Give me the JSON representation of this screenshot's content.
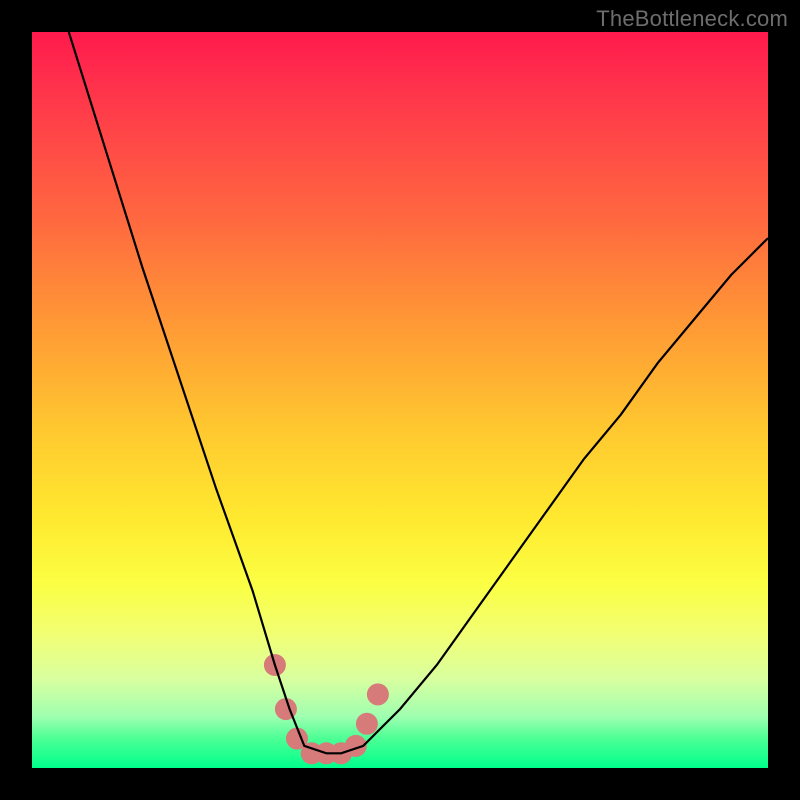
{
  "watermark": "TheBottleneck.com",
  "chart_data": {
    "type": "line",
    "title": "",
    "xlabel": "",
    "ylabel": "",
    "xlim": [
      0,
      100
    ],
    "ylim": [
      0,
      100
    ],
    "grid": false,
    "legend": false,
    "series": [
      {
        "name": "bottleneck-curve",
        "x": [
          5,
          10,
          15,
          20,
          25,
          30,
          33,
          35,
          37,
          40,
          42,
          45,
          50,
          55,
          60,
          65,
          70,
          75,
          80,
          85,
          90,
          95,
          100
        ],
        "y": [
          100,
          84,
          68,
          53,
          38,
          24,
          14,
          8,
          3,
          2,
          2,
          3,
          8,
          14,
          21,
          28,
          35,
          42,
          48,
          55,
          61,
          67,
          72
        ]
      }
    ],
    "highlight": {
      "name": "optimal-zone",
      "x": [
        33,
        34.5,
        36,
        38,
        40,
        42,
        44,
        45.5,
        47
      ],
      "y": [
        14,
        8,
        4,
        2,
        2,
        2,
        3,
        6,
        10
      ]
    },
    "colors": {
      "curve": "#000000",
      "highlight_marker": "#d77a7a"
    }
  }
}
